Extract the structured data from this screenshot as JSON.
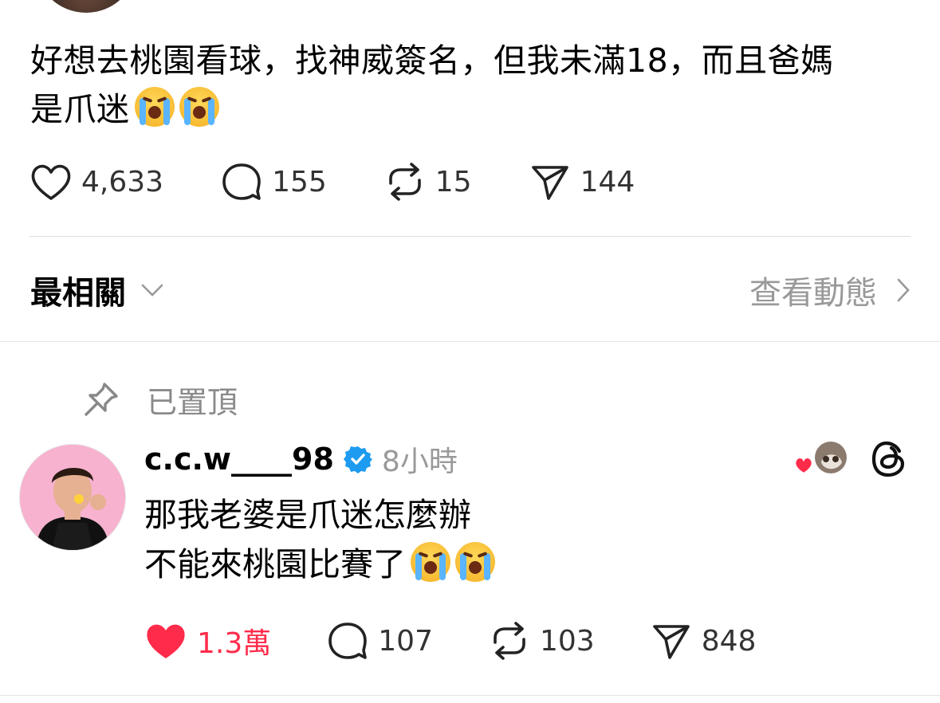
{
  "post": {
    "text_line1": "好想去桃園看球，找神威簽名，但我未滿18，而且爸媽",
    "text_line2": "是爪迷",
    "emoji": [
      "loudly-crying-face",
      "loudly-crying-face"
    ],
    "likes": "4,633",
    "replies": "155",
    "reposts": "15",
    "shares": "144"
  },
  "sort": {
    "label": "最相關",
    "activity_link": "查看動態"
  },
  "pinned": {
    "label": "已置頂"
  },
  "reply": {
    "username": "c.c.w____98",
    "verified": true,
    "time": "8小時",
    "text_line1": "那我老婆是爪迷怎麼辦",
    "text_line2": "不能來桃園比賽了",
    "emoji": [
      "loudly-crying-face",
      "loudly-crying-face"
    ],
    "likes": "1.3萬",
    "liked": true,
    "replies": "107",
    "reposts": "103",
    "shares": "848"
  },
  "colors": {
    "like_active": "#ff2b4a",
    "verified_blue": "#1d9bf0",
    "muted_text": "#999999"
  }
}
